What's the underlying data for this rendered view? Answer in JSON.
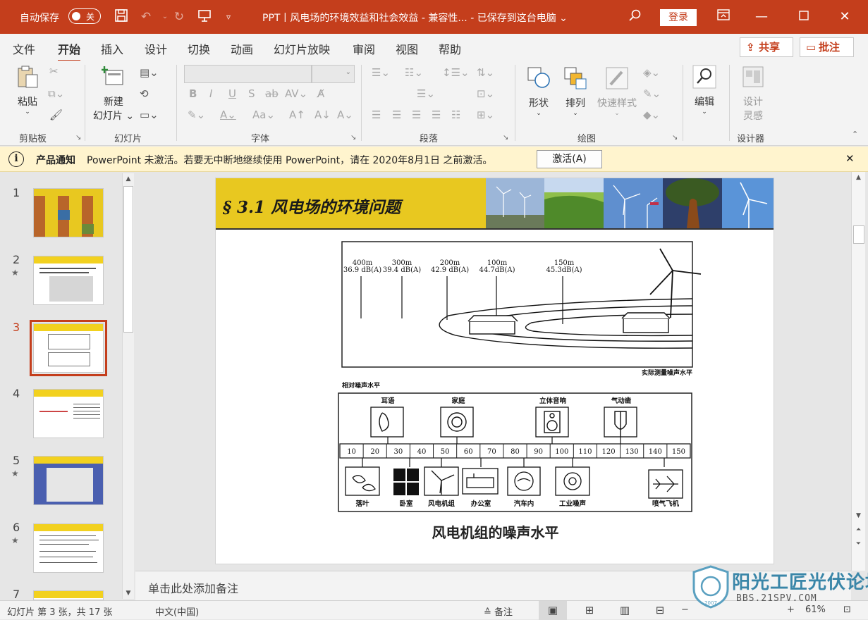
{
  "titlebar": {
    "autosave_label": "自动保存",
    "autosave_state": "关",
    "document_title": "PPT丨风电场的环境效益和社会效益  -  兼容性...  -  已保存到这台电脑",
    "login_label": "登录"
  },
  "menu": {
    "items": [
      "文件",
      "开始",
      "插入",
      "设计",
      "切换",
      "动画",
      "幻灯片放映",
      "审阅",
      "视图",
      "帮助"
    ],
    "active": "开始",
    "share_label": "共享",
    "comment_label": "批注"
  },
  "ribbon": {
    "groups": [
      "剪贴板",
      "幻灯片",
      "字体",
      "段落",
      "绘图",
      "设计器"
    ],
    "paste_label": "粘贴",
    "new_slide_line1": "新建",
    "new_slide_line2": "幻灯片",
    "shapes_label": "形状",
    "arrange_label": "排列",
    "quick_styles_label": "快速样式",
    "edit_label": "编辑",
    "design_ideas_line1": "设计",
    "design_ideas_line2": "灵感"
  },
  "notice": {
    "title": "产品通知",
    "message": "PowerPoint 未激活。若要无中断地继续使用 PowerPoint，请在 2020年8月1日 之前激活。",
    "activate_label": "激活(A)"
  },
  "thumbnails": [
    {
      "num": "1",
      "star": false
    },
    {
      "num": "2",
      "star": true
    },
    {
      "num": "3",
      "star": false,
      "selected": true
    },
    {
      "num": "4",
      "star": false
    },
    {
      "num": "5",
      "star": true
    },
    {
      "num": "6",
      "star": true
    },
    {
      "num": "7",
      "star": false
    }
  ],
  "slide": {
    "title": "§ 3.1 风电场的环境问题",
    "distances": [
      {
        "d": "400m",
        "db": "36.9 dB(A)"
      },
      {
        "d": "300m",
        "db": "39.4 dB(A)"
      },
      {
        "d": "200m",
        "db": "42.9 dB(A)"
      },
      {
        "d": "100m",
        "db": "44.7dB(A)"
      },
      {
        "d": "150m",
        "db": "45.3dB(A)"
      }
    ],
    "measured_label": "实际测量噪声水平",
    "relative_label": "相对噪声水平",
    "top_sources": [
      "耳语",
      "家庭",
      "立体音响",
      "气动凿"
    ],
    "scale": [
      "10",
      "20",
      "30",
      "40",
      "50",
      "60",
      "70",
      "80",
      "90",
      "100",
      "110",
      "120",
      "130",
      "140",
      "150"
    ],
    "bottom_sources": [
      "落叶",
      "卧室",
      "风电机组",
      "办公室",
      "汽车内",
      "工业噪声",
      "喷气飞机"
    ],
    "caption": "风电机组的噪声水平"
  },
  "notes_placeholder": "单击此处添加备注",
  "status": {
    "slide_info": "幻灯片 第 3 张，共 17 张",
    "language": "中文(中国)",
    "notes_label": "备注",
    "zoom": "61%"
  },
  "watermark": {
    "text": "阳光工匠光伏论坛",
    "url": "BBS.21SPV.COM",
    "year": "2007"
  },
  "colors": {
    "accent": "#c43e1c",
    "slide_band": "#e8c820",
    "notice_bg": "#fff4ce"
  }
}
